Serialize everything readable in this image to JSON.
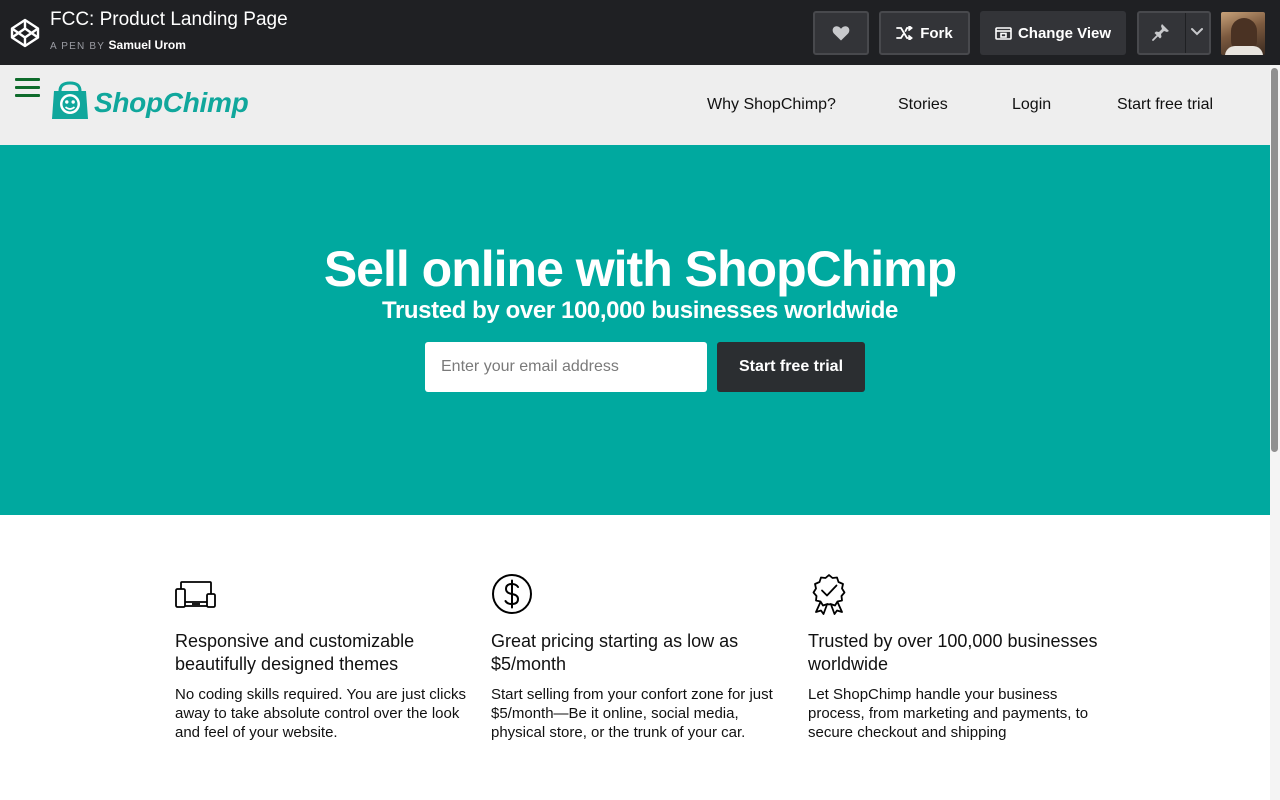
{
  "codepen": {
    "pen_title": "FCC: Product Landing Page",
    "by_prefix": "A PEN BY",
    "author": "Samuel Urom",
    "fork_label": "Fork",
    "change_view_label": "Change View",
    "icons": [
      "codepen-logo-icon",
      "heart-icon",
      "fork-icon",
      "change-view-icon",
      "pin-icon",
      "chevron-down-icon"
    ]
  },
  "nav": {
    "brand": "ShopChimp",
    "links": [
      "Why ShopChimp?",
      "Stories",
      "Login",
      "Start free trial"
    ]
  },
  "hero": {
    "title": "Sell online with ShopChimp",
    "subtitle": "Trusted by over 100,000 businesses worldwide",
    "email_placeholder": "Enter your email address",
    "cta_label": "Start free trial"
  },
  "features": [
    {
      "icon": "devices-icon",
      "title": "Responsive and customizable beautifully designed themes",
      "body": "No coding skills required. You are just clicks away to take absolute control over the look and feel of your website."
    },
    {
      "icon": "dollar-icon",
      "title": "Great pricing starting as low as $5/month",
      "body": "Start selling from your confort zone for just $5/month—Be it online, social media, physical store, or the trunk of your car."
    },
    {
      "icon": "award-icon",
      "title": "Trusted by over 100,000 businesses worldwide",
      "body": "Let ShopChimp handle your business process, from marketing and payments, to secure checkout and shipping"
    }
  ],
  "colors": {
    "accent": "#00a99f",
    "brand_text": "#10a79c",
    "hamburger": "#0e6b2b",
    "topbar": "#1f2023",
    "cta_button": "#2b2e31"
  }
}
